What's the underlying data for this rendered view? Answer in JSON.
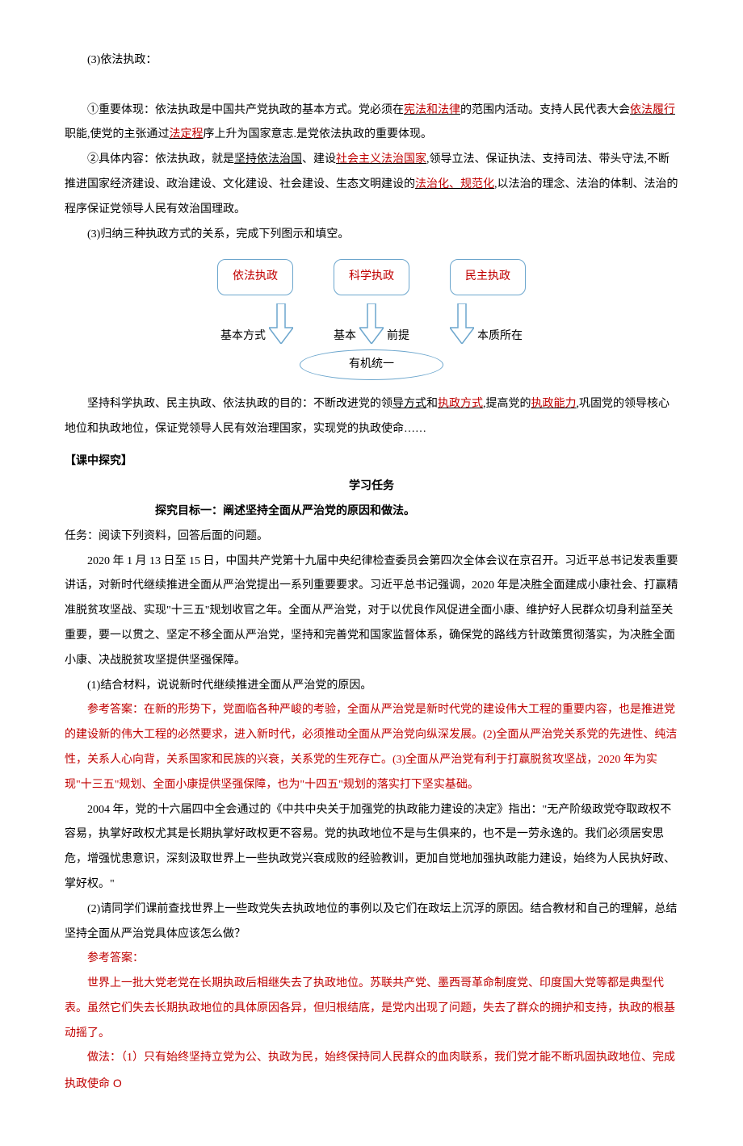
{
  "s1": {
    "heading": "(3)依法执政：",
    "p1a": "①重要体现：依法执政是中国共产党执政的基本方式。党必须在",
    "p1u1": "宪法和法律",
    "p1b": "的范围内活动。支持人民代表大会",
    "p1u2": "依法履行",
    "p1c": "职能,使党的主张通过",
    "p1u3": "法定程",
    "p1d": "序上升为国家意志.是党依法执政的重要体现。",
    "p2a": "②具体内容：依法执政，就是",
    "p2u1": "坚持依法治国",
    "p2b": "、建设",
    "p2u2": "社会主义法治国家",
    "p2c": ",领导立法、保证执法、支持司法、带头守法,不断推进国家经济建设、政治建设、文化建设、社会建设、生态文明建设的",
    "p2u3": "法治化、规范化",
    "p2d": ",以法治的理念、法治的体制、法治的程序保证党领导人民有效治国理政。",
    "p3": "(3)归纳三种执政方式的关系，完成下列图示和填空。"
  },
  "diagram": {
    "box1": "依法执政",
    "box2": "科学执政",
    "box3": "民主执政",
    "label1": "基本方式",
    "label2a": "基本",
    "label2b": "前提",
    "label3": "本质所在",
    "ellipse": "有机统一"
  },
  "s2": {
    "p1a": "坚持科学执政、民主执政、依法执政的目的：不断改进党的领",
    "p1u1": "导方式",
    "p1b": "和",
    "p1u2": "执政方式",
    "p1c": ",提高党的",
    "p1u3": "执政能力",
    "p1d": ",巩固党的领导核心地位和执政地位，保证党领导人民有效治理国家，实现党的执政使命……"
  },
  "s3": {
    "head": "【课中探究】",
    "taskTitle": "学习任务",
    "goal": "探究目标一：阐述坚持全面从严治党的原因和做法。",
    "task": "任务：阅读下列资料，回答后面的问题。",
    "para1": "2020 年 1 月 13 日至 15 日，中国共产党第十九届中央纪律检查委员会第四次全体会议在京召开。习近平总书记发表重要讲话，对新时代继续推进全面从严治党提出一系列重要要求。习近平总书记强调，2020 年是决胜全面建成小康社会、打赢精准脱贫攻坚战、实现\"十三五\"规划收官之年。全面从严治党，对于以优良作风促进全面小康、维护好人民群众切身利益至关重要，要一以贯之、坚定不移全面从严治党，坚持和完善党和国家监督体系，确保党的路线方针政策贯彻落实，为决胜全面小康、决战脱贫攻坚提供坚强保障。",
    "q1": "(1)结合材料，说说新时代继续推进全面从严治党的原因。",
    "ans1": "参考答案：在新的形势下，党面临各种严峻的考验，全面从严治党是新时代党的建设伟大工程的重要内容，也是推进党的建设新的伟大工程的必然要求，进入新时代，必须推动全面从严治党向纵深发展。(2)全面从严治党关系党的先进性、纯洁性，关系人心向背，关系国家和民族的兴衰，关系党的生死存亡。(3)全面从严治党有利于打赢脱贫攻坚战，2020 年为实现\"十三五\"规划、全面小康提供坚强保障，也为\"十四五\"规划的落实打下坚实基础。",
    "para2": "2004 年，党的十六届四中全会通过的《中共中央关于加强党的执政能力建设的决定》指出：\"无产阶级政党夺取政权不容易，执掌好政权尤其是长期执掌好政权更不容易。党的执政地位不是与生俱来的，也不是一劳永逸的。我们必须居安思危，增强忧患意识，深刻汲取世界上一些执政党兴衰成败的经验教训，更加自觉地加强执政能力建设，始终为人民执好政、掌好权。\"",
    "q2": "(2)请同学们课前查找世界上一些政党失去执政地位的事例以及它们在政坛上沉浮的原因。结合教材和自己的理解，总结坚持全面从严治党具体应该怎么做？",
    "ans2h": "参考答案：",
    "ans2a": "世界上一批大党老党在长期执政后相继失去了执政地位。苏联共产党、墨西哥革命制度党、印度国大党等都是典型代表。虽然它们失去长期执政地位的具体原因各异，但归根结底，是党内出现了问题，失去了群众的拥护和支持，执政的根基动摇了。",
    "ans2b_a": "做法：（1）只有始终坚持立党为公、执政为民，始终保持同人民群众的血肉联系，我们党才能不断巩固执政地位、完成执政使命",
    "ans2b_o": " O"
  }
}
